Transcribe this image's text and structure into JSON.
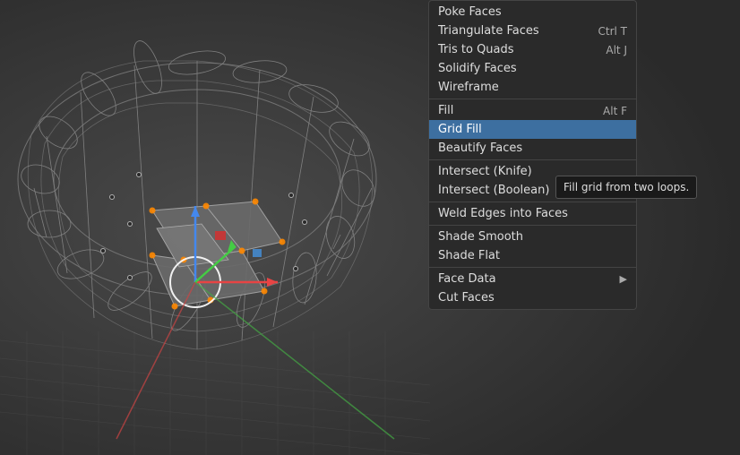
{
  "viewport": {
    "background_color": "#3a3a3a"
  },
  "context_menu": {
    "items": [
      {
        "id": "poke-faces",
        "label": "Poke Faces",
        "shortcut": "",
        "has_arrow": false,
        "separator_after": false,
        "active": false
      },
      {
        "id": "triangulate-faces",
        "label": "Triangulate Faces",
        "shortcut": "Ctrl T",
        "has_arrow": false,
        "separator_after": false,
        "active": false
      },
      {
        "id": "tris-to-quads",
        "label": "Tris to Quads",
        "shortcut": "Alt J",
        "has_arrow": false,
        "separator_after": false,
        "active": false
      },
      {
        "id": "solidify-faces",
        "label": "Solidify Faces",
        "shortcut": "",
        "has_arrow": false,
        "separator_after": false,
        "active": false
      },
      {
        "id": "wireframe",
        "label": "Wireframe",
        "shortcut": "",
        "has_arrow": false,
        "separator_after": false,
        "active": false
      },
      {
        "id": "separator1",
        "label": "",
        "separator": true
      },
      {
        "id": "fill",
        "label": "Fill",
        "shortcut": "Alt F",
        "has_arrow": false,
        "separator_after": false,
        "active": false
      },
      {
        "id": "grid-fill",
        "label": "Grid Fill",
        "shortcut": "",
        "has_arrow": false,
        "separator_after": false,
        "active": true
      },
      {
        "id": "beautify-faces",
        "label": "Beautify Faces",
        "shortcut": "",
        "has_arrow": false,
        "separator_after": false,
        "active": false
      },
      {
        "id": "separator2",
        "label": "",
        "separator": true
      },
      {
        "id": "intersect-knife",
        "label": "Intersect (Knife)",
        "shortcut": "",
        "has_arrow": false,
        "separator_after": false,
        "active": false
      },
      {
        "id": "intersect-boolean",
        "label": "Intersect (Boolean)",
        "shortcut": "",
        "has_arrow": false,
        "separator_after": false,
        "active": false
      },
      {
        "id": "separator3",
        "label": "",
        "separator": true
      },
      {
        "id": "weld-edges",
        "label": "Weld Edges into Faces",
        "shortcut": "",
        "has_arrow": false,
        "separator_after": false,
        "active": false
      },
      {
        "id": "separator4",
        "label": "",
        "separator": true
      },
      {
        "id": "shade-smooth",
        "label": "Shade Smooth",
        "shortcut": "",
        "has_arrow": false,
        "separator_after": false,
        "active": false
      },
      {
        "id": "shade-flat",
        "label": "Shade Flat",
        "shortcut": "",
        "has_arrow": false,
        "separator_after": false,
        "active": false
      },
      {
        "id": "separator5",
        "label": "",
        "separator": true
      },
      {
        "id": "face-data",
        "label": "Face Data",
        "shortcut": "",
        "has_arrow": true,
        "separator_after": false,
        "active": false
      },
      {
        "id": "cut-faces",
        "label": "Cut Faces",
        "shortcut": "",
        "has_arrow": false,
        "separator_after": false,
        "active": false
      }
    ]
  },
  "tooltip": {
    "text": "Fill grid from two loops."
  }
}
